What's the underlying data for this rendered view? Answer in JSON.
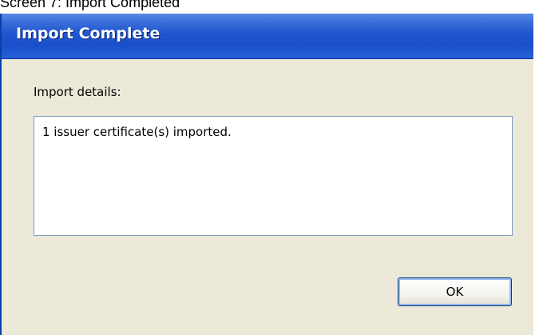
{
  "caption": "Screen 7: Import Completed",
  "window": {
    "title": "Import Complete"
  },
  "content": {
    "details_label": "Import details:",
    "details_text": "1 issuer certificate(s) imported."
  },
  "buttons": {
    "ok_label": "OK"
  },
  "colors": {
    "titlebar": "#1f55cf",
    "window_bg": "#ece9d8",
    "box_border": "#7f9db9",
    "button_border": "#003c74"
  }
}
